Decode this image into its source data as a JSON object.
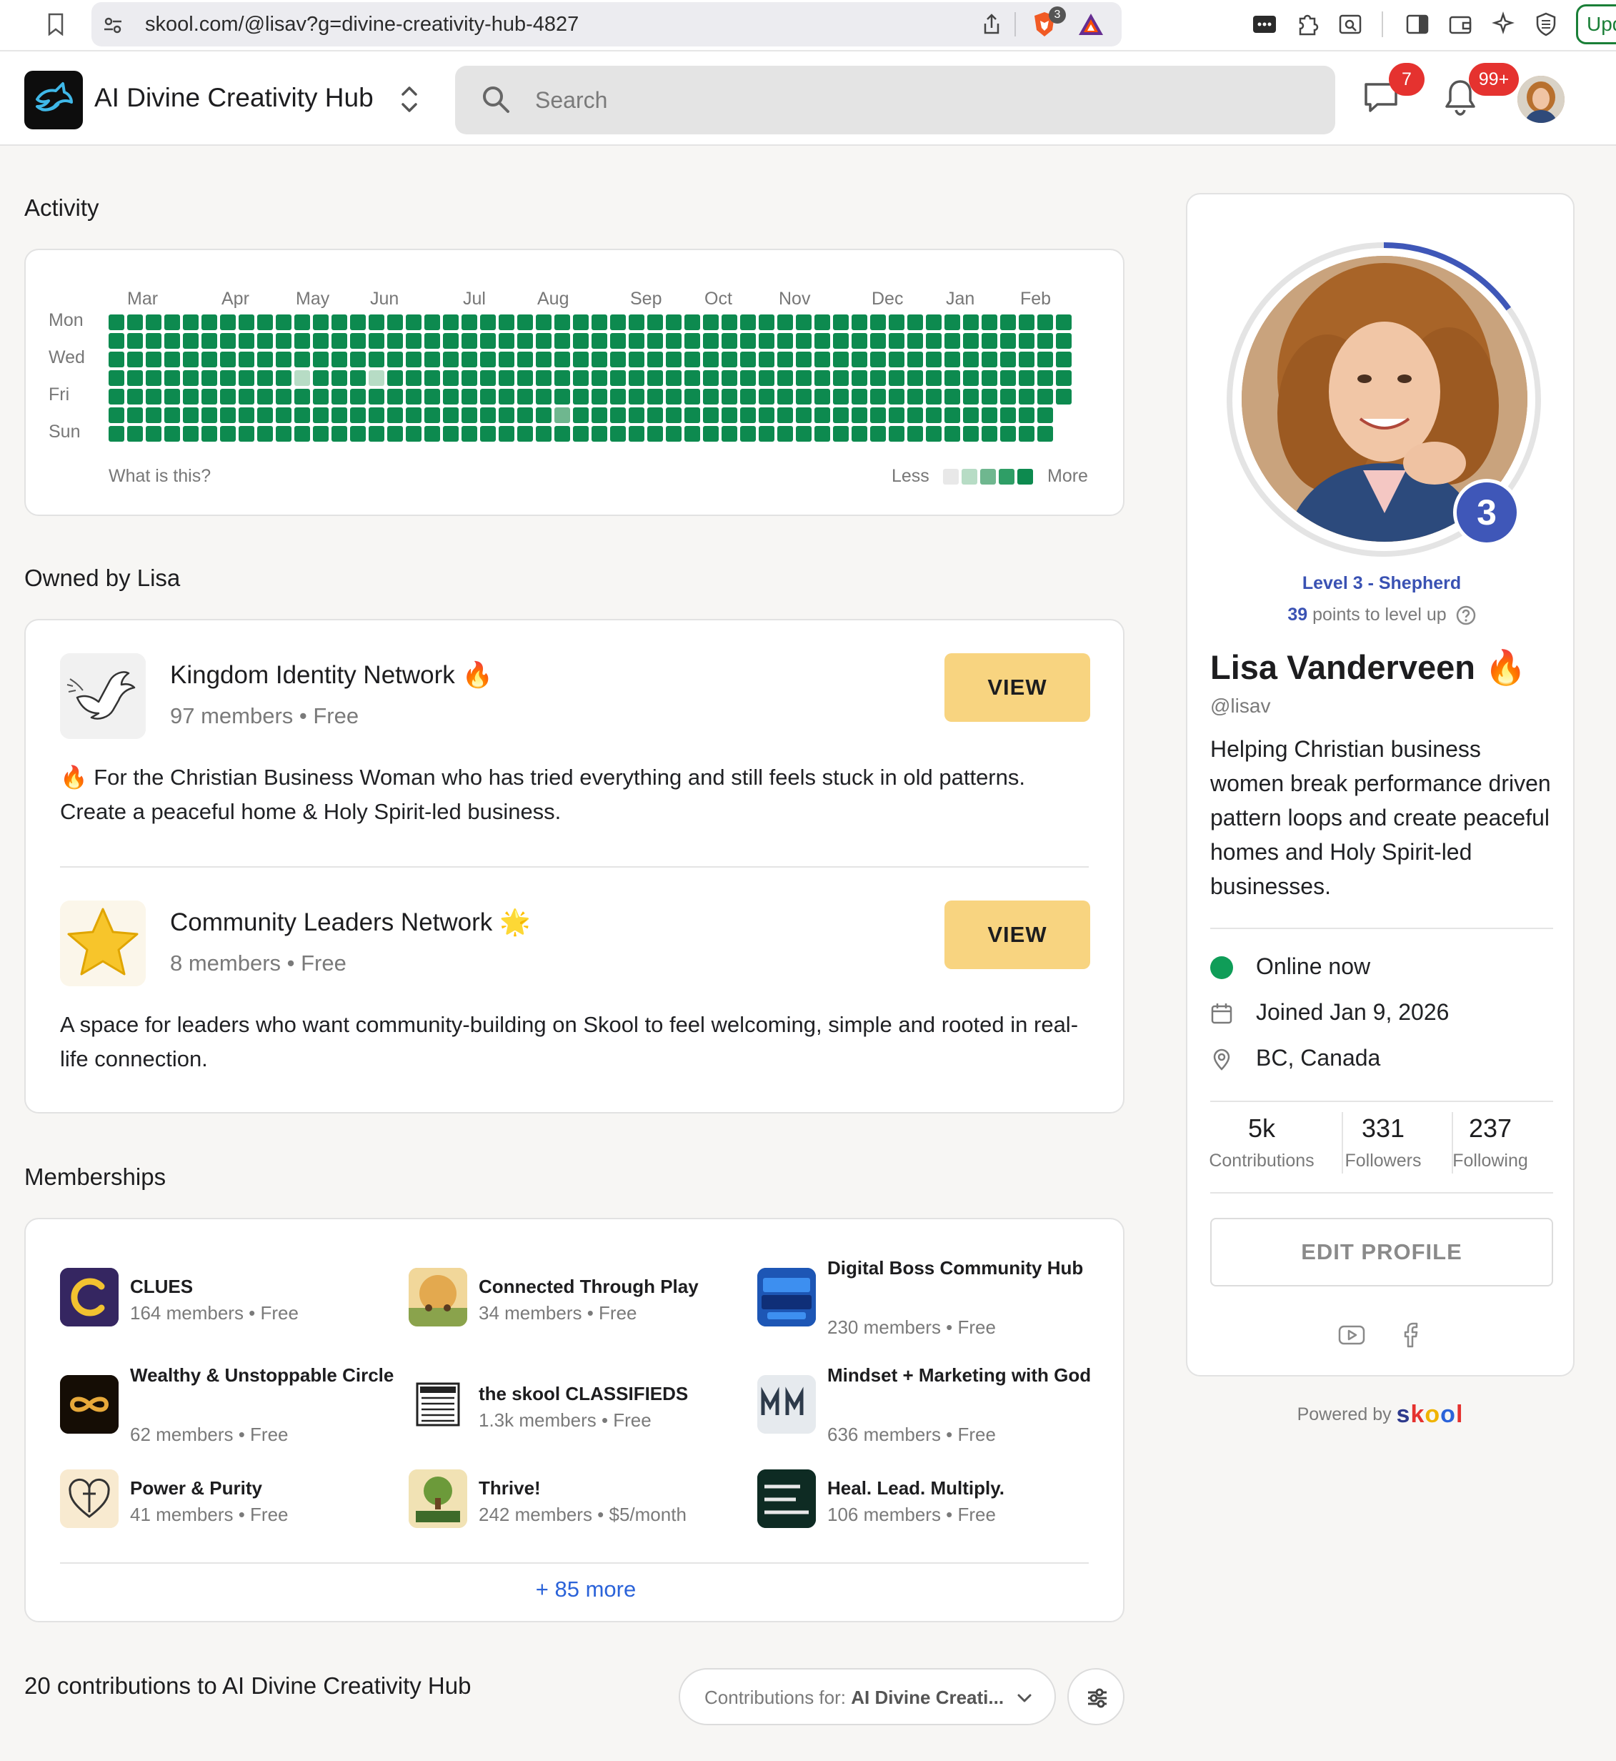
{
  "browser": {
    "url": "skool.com/@lisav?g=divine-creativity-hub-4827",
    "brave_shield_count": "3",
    "update_label": "Upd"
  },
  "header": {
    "group_name": "AI Divine Creativity Hub",
    "search_placeholder": "Search",
    "chat_badge": "7",
    "notif_badge": "99+"
  },
  "activity": {
    "title": "Activity",
    "months": [
      "Mar",
      "Apr",
      "May",
      "Jun",
      "Jul",
      "Aug",
      "Sep",
      "Oct",
      "Nov",
      "Dec",
      "Jan",
      "Feb"
    ],
    "days": [
      "Mon",
      "Wed",
      "Fri",
      "Sun"
    ],
    "what_is_this": "What is this?",
    "legend_less": "Less",
    "legend_more": "More"
  },
  "owned": {
    "title": "Owned by Lisa",
    "items": [
      {
        "name": "Kingdom Identity Network 🔥",
        "meta": "97 members • Free",
        "view_label": "VIEW",
        "description": "🔥 For the Christian Business Woman who has tried everything and still feels stuck in old patterns. Create a peaceful home & Holy Spirit-led business."
      },
      {
        "name": "Community Leaders Network 🌟",
        "meta": "8 members • Free",
        "view_label": "VIEW",
        "description": "A space for leaders who want community-building on Skool to feel welcoming, simple and rooted in real-life connection."
      }
    ]
  },
  "memberships": {
    "title": "Memberships",
    "items": [
      {
        "name": "CLUES",
        "meta": "164 members • Free"
      },
      {
        "name": "Connected Through Play",
        "meta": "34 members • Free"
      },
      {
        "name": "Digital Boss Community Hub",
        "meta": "230 members • Free"
      },
      {
        "name": "Wealthy & Unstoppable Circle",
        "meta": "62 members • Free"
      },
      {
        "name": "the skool CLASSIFIEDS",
        "meta": "1.3k members • Free"
      },
      {
        "name": "Mindset + Marketing with God",
        "meta": "636 members • Free"
      },
      {
        "name": "Power & Purity",
        "meta": "41 members • Free"
      },
      {
        "name": "Thrive!",
        "meta": "242 members • $5/month"
      },
      {
        "name": "Heal. Lead. Multiply.",
        "meta": "106 members • Free"
      }
    ],
    "more_label": "+ 85 more"
  },
  "contributions": {
    "title": "20 contributions to AI Divine Creativity Hub",
    "filter_prefix": "Contributions for: ",
    "filter_value": "AI Divine Creati..."
  },
  "profile": {
    "level_number": "3",
    "level_title": "Level 3 - Shepherd",
    "points": "39",
    "points_suffix": " points to level up",
    "name": "Lisa Vanderveen 🔥",
    "handle": "@lisav",
    "bio": "Helping Christian business women break performance driven pattern loops and create peaceful homes and Holy Spirit-led businesses.",
    "status": "Online now",
    "joined": "Joined Jan 9, 2026",
    "location": "BC, Canada",
    "stats": [
      {
        "value": "5k",
        "label": "Contributions"
      },
      {
        "value": "331",
        "label": "Followers"
      },
      {
        "value": "237",
        "label": "Following"
      }
    ],
    "edit_label": "EDIT PROFILE",
    "level_progress": 0.15
  },
  "footer": {
    "powered_by": "Powered by ",
    "brand": "skool"
  },
  "colors": {
    "activity_green": "#0d8a4f",
    "view_button": "#f8d480",
    "level_blue": "#3f57b8",
    "badge_red": "#e5322f",
    "link_blue": "#2b63d9"
  }
}
